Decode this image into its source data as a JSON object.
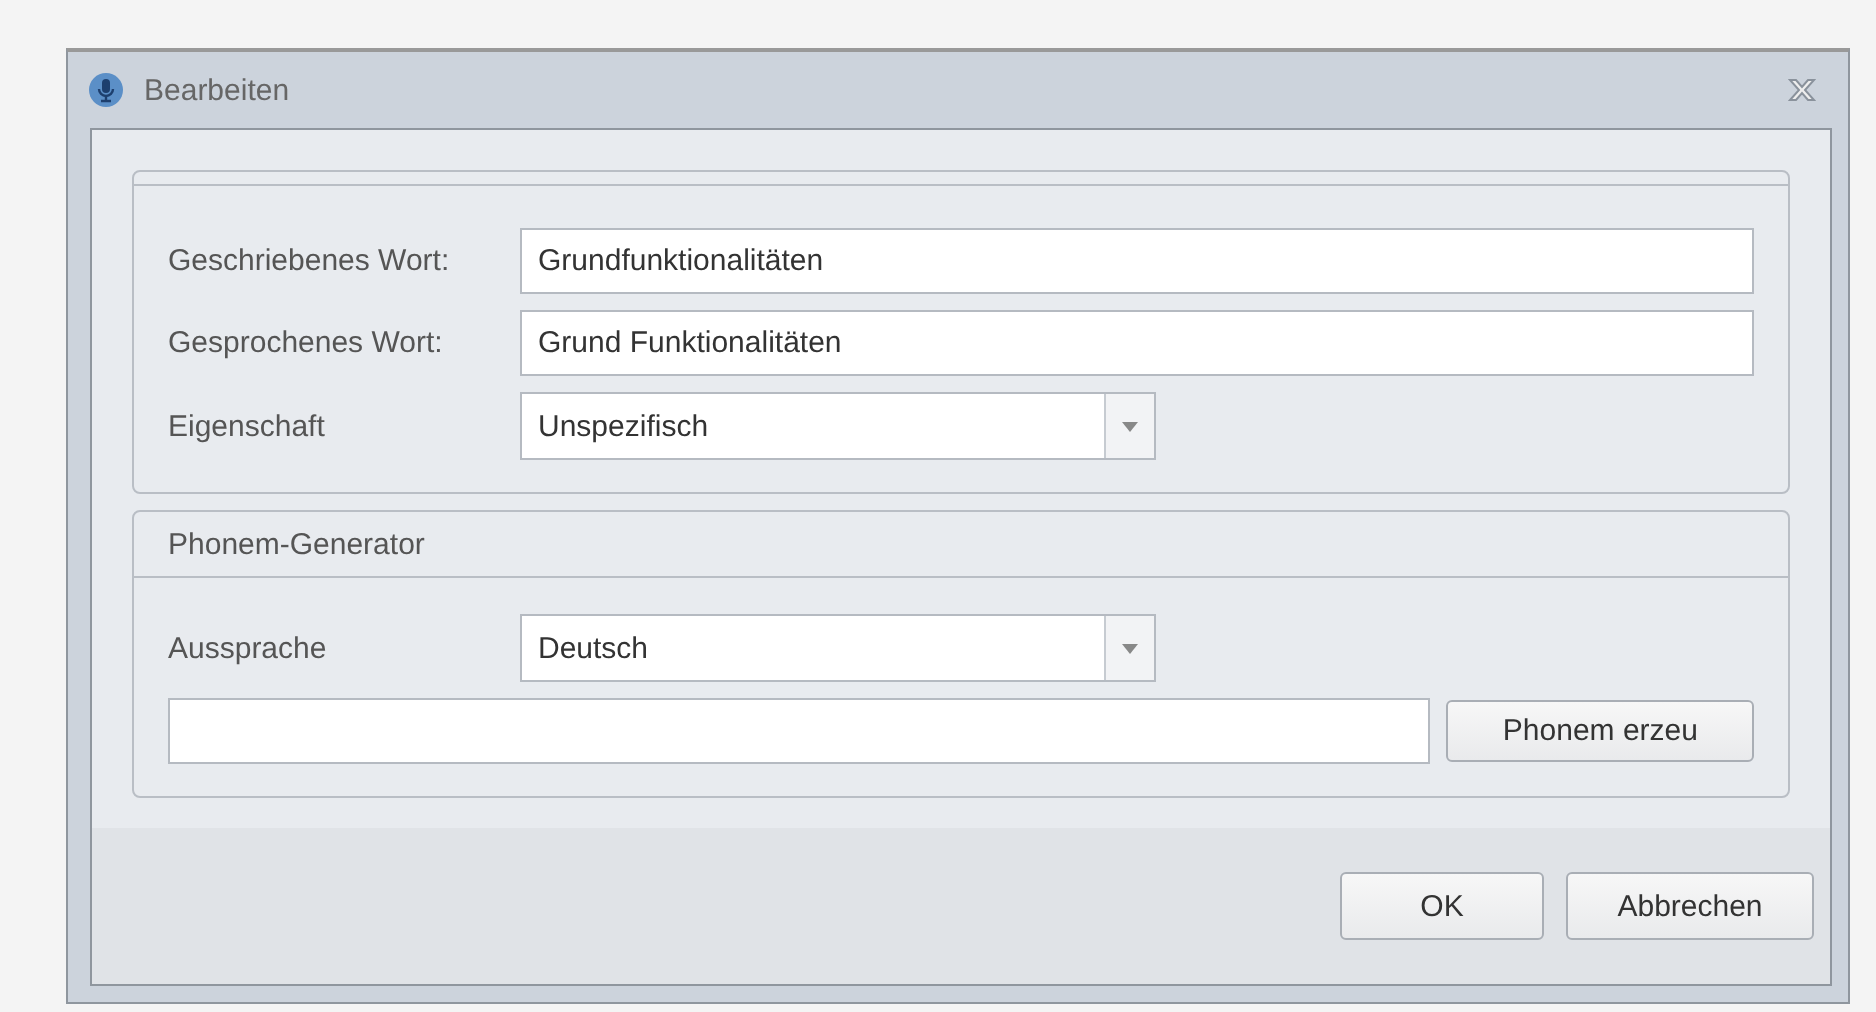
{
  "window": {
    "title": "Bearbeiten"
  },
  "word_group": {
    "fields": [
      {
        "kind": "text",
        "label": "Geschriebenes Wort:",
        "value": "Grundfunktionalitäten"
      },
      {
        "kind": "text",
        "label": "Gesprochenes Wort:",
        "value": "Grund Funktionalitäten"
      },
      {
        "kind": "dropdown",
        "label": "Eigenschaft",
        "value": "Unspezifisch"
      }
    ]
  },
  "phoneme_group": {
    "title": "Phonem-Generator",
    "fields": [
      {
        "kind": "dropdown",
        "label": "Aussprache",
        "value": "Deutsch"
      }
    ],
    "generate_button": "Phonem erzeu"
  },
  "buttons": [
    "OK",
    "Abbrechen"
  ]
}
